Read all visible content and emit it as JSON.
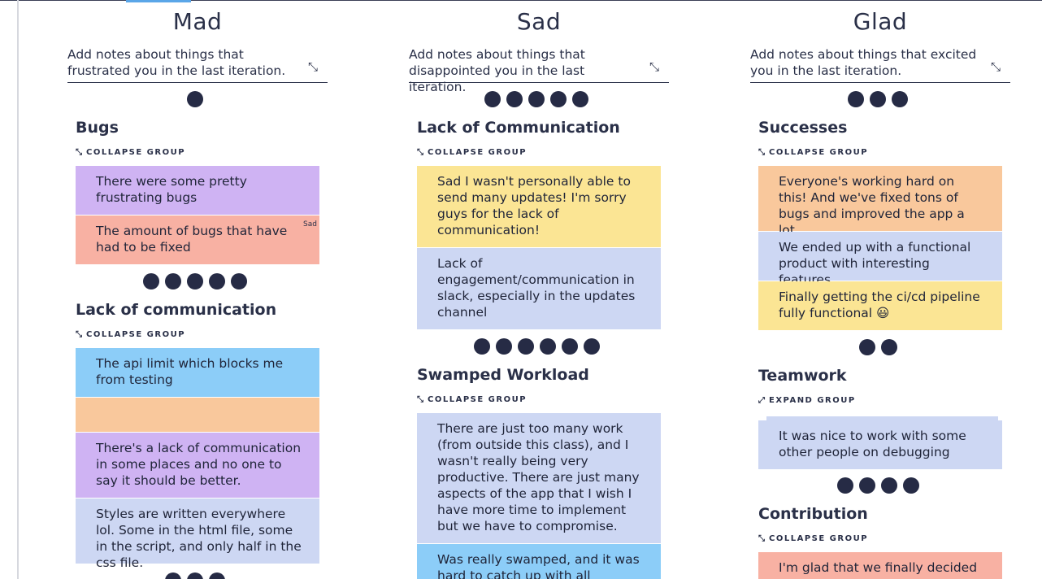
{
  "columns": [
    {
      "title": "Mad",
      "description": "Add notes about things that frustrated you in the last iteration.",
      "groups": [
        {
          "title": "Bugs",
          "toggle_label": "COLLAPSE GROUP",
          "notes": [
            {
              "text": "There were some pretty frustrating bugs",
              "color": "#cfb3f3"
            },
            {
              "text": "The amount of bugs that have had to be fixed",
              "color": "#f8b1a3",
              "tag": "Sad"
            }
          ]
        },
        {
          "title": "Lack of communication",
          "toggle_label": "COLLAPSE GROUP",
          "notes": [
            {
              "text": "The api limit which blocks me from testing",
              "color": "#8ccdf8"
            },
            {
              "text": "",
              "color": "#f9c89c"
            },
            {
              "text": "There's a lack of communication in some places and no one to say it should be better.",
              "color": "#cfb3f3"
            },
            {
              "text": "Styles are written everywhere lol. Some in the html file, some in the script, and only half in the css file.",
              "color": "#cdd7f3"
            }
          ]
        }
      ],
      "vote_dots": [
        1,
        5,
        3
      ]
    },
    {
      "title": "Sad",
      "description": "Add notes about things that disappointed you in the last iteration.",
      "groups": [
        {
          "title": "Lack of Communication",
          "toggle_label": "COLLAPSE GROUP",
          "notes": [
            {
              "text": "Sad I wasn't personally able to send many updates! I'm sorry guys for the lack of communication!",
              "color": "#fbe594"
            },
            {
              "text": "Lack of engagement/communication in slack, especially in the updates channel",
              "color": "#cdd7f3"
            }
          ]
        },
        {
          "title": "Swamped Workload",
          "toggle_label": "COLLAPSE GROUP",
          "notes": [
            {
              "text": "There are just too many work (from outside this class), and I wasn't really being very productive. There are just many aspects of the app that I wish I have more time to implement but we have to compromise.",
              "color": "#cdd7f3"
            },
            {
              "text": "Was really swamped, and it was hard to catch up with all",
              "color": "#8ccdf8"
            }
          ]
        }
      ],
      "vote_dots": [
        5,
        6
      ]
    },
    {
      "title": "Glad",
      "description": "Add notes about things that excited you in the last iteration.",
      "groups": [
        {
          "title": "Successes",
          "toggle_label": "COLLAPSE GROUP",
          "notes": [
            {
              "text": "Everyone's working hard on this! And we've fixed tons of bugs and improved the app a lot.",
              "color": "#f9c89c"
            },
            {
              "text": "We ended up with a functional product with interesting features",
              "color": "#cdd7f3"
            },
            {
              "text": "Finally getting the ci/cd pipeline fully functional 😃",
              "color": "#fbe594"
            }
          ]
        },
        {
          "title": "Teamwork",
          "toggle_label": "EXPAND GROUP",
          "notes": [
            {
              "text": "It was nice to work with some other people on debugging",
              "color": "#cdd7f3"
            }
          ]
        },
        {
          "title": "Contribution",
          "toggle_label": "COLLAPSE GROUP",
          "notes": [
            {
              "text": "I'm glad that we finally decided to",
              "color": "#f8b1a3"
            }
          ]
        }
      ],
      "vote_dots": [
        3,
        2,
        4
      ]
    }
  ],
  "icons": {
    "collapse": "⤡",
    "expand": "⤢"
  }
}
